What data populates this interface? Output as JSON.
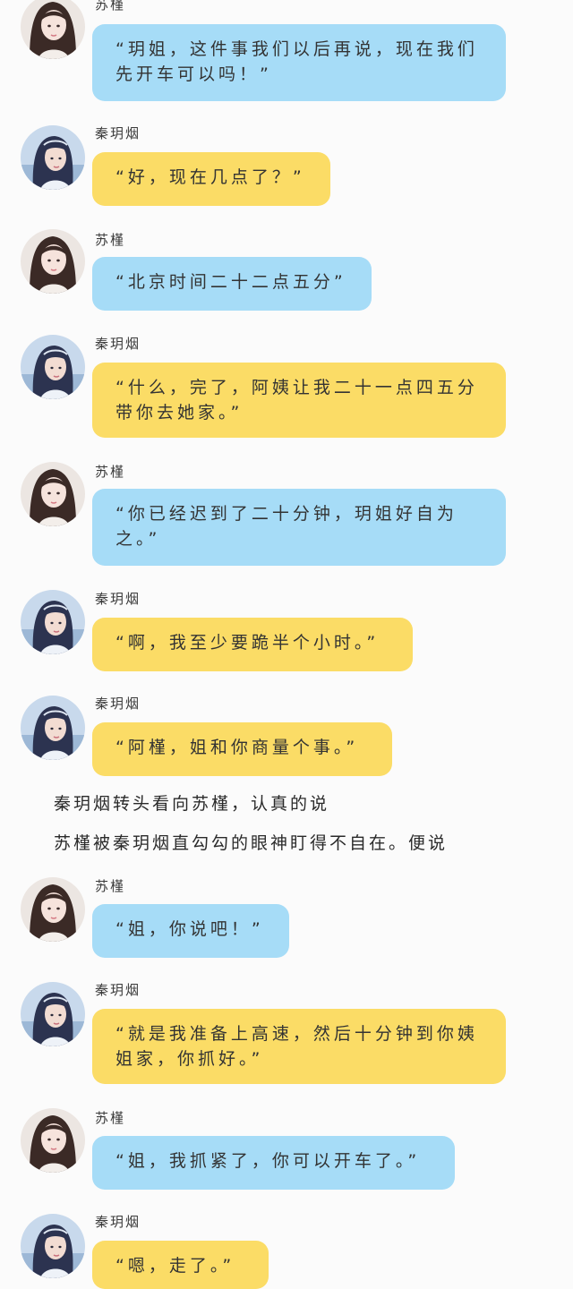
{
  "messages": [
    {
      "speaker": "苏槿",
      "text": "“玥姐，这件事我们以后再说，现在我们先开车可以吗！”",
      "color": "blue"
    },
    {
      "speaker": "秦玥烟",
      "text": "“好，现在几点了？”",
      "color": "yellow"
    },
    {
      "speaker": "苏槿",
      "text": "“北京时间二十二点五分”",
      "color": "blue"
    },
    {
      "speaker": "秦玥烟",
      "text": "“什么，完了，阿姨让我二十一点四五分带你去她家。”",
      "color": "yellow"
    },
    {
      "speaker": "苏槿",
      "text": "“你已经迟到了二十分钟，玥姐好自为之。”",
      "color": "blue"
    },
    {
      "speaker": "秦玥烟",
      "text": "“啊，我至少要跪半个小时。”",
      "color": "yellow"
    },
    {
      "speaker": "秦玥烟",
      "text": "“阿槿，姐和你商量个事。”",
      "color": "yellow"
    },
    {
      "speaker": "苏槿",
      "text": "“姐，你说吧！”",
      "color": "blue"
    },
    {
      "speaker": "秦玥烟",
      "text": "“就是我准备上高速，然后十分钟到你姨姐家，你抓好。”",
      "color": "yellow"
    },
    {
      "speaker": "苏槿",
      "text": "“姐，我抓紧了，你可以开车了。”",
      "color": "blue"
    },
    {
      "speaker": "秦玥烟",
      "text": "“嗯，走了。”",
      "color": "yellow"
    }
  ],
  "narration": [
    "秦玥烟转头看向苏槿，认真的说",
    "苏槿被秦玥烟直勾勾的眼神盯得不自在。便说"
  ],
  "colors": {
    "blue_bubble": "#a6dcf7",
    "yellow_bubble": "#fbdc66",
    "background": "#fbfbfb"
  },
  "avatars": {
    "苏槿": "girl-portrait-avatar",
    "秦玥烟": "blue-hair-girl-avatar"
  }
}
